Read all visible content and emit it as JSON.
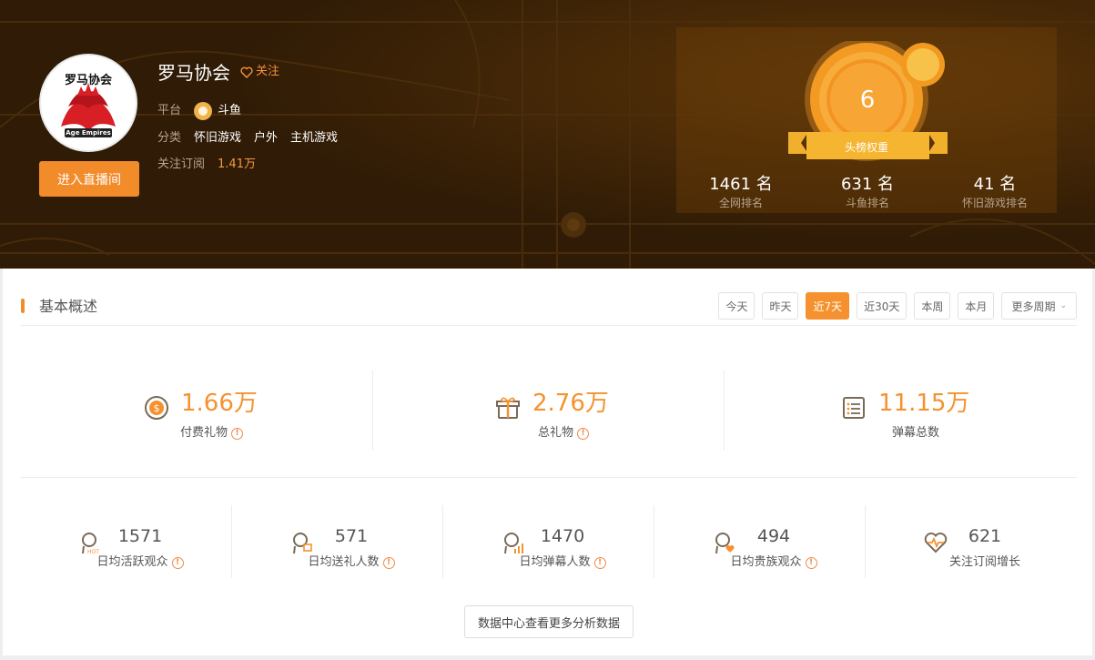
{
  "profile": {
    "avatar_text_top": "罗马协会",
    "avatar_text_bottom": "Age Empires",
    "name": "罗马协会",
    "follow_label": "关注",
    "enter_button": "进入直播间",
    "platform_label": "平台",
    "platform_value": "斗鱼",
    "category_label": "分类",
    "categories": [
      "怀旧游戏",
      "户外",
      "主机游戏"
    ],
    "fans_label": "关注订阅",
    "fans_value": "1.41万"
  },
  "medal": {
    "value": "6",
    "label": "头榜权重"
  },
  "ranks": [
    {
      "value": "1461 名",
      "label": "全网排名"
    },
    {
      "value": "631 名",
      "label": "斗鱼排名"
    },
    {
      "value": "41 名",
      "label": "怀旧游戏排名"
    }
  ],
  "overview": {
    "title": "基本概述",
    "periods": [
      "今天",
      "昨天",
      "近7天",
      "近30天",
      "本周",
      "本月"
    ],
    "active_period": "近7天",
    "more_periods": "更多周期",
    "big_stats": [
      {
        "value": "1.66万",
        "label": "付费礼物",
        "icon": "coin-icon"
      },
      {
        "value": "2.76万",
        "label": "总礼物",
        "icon": "gift-icon"
      },
      {
        "value": "11.15万",
        "label": "弹幕总数",
        "icon": "list-icon"
      }
    ],
    "small_stats": [
      {
        "value": "1571",
        "label": "日均活跃观众",
        "icon": "user-hot-icon",
        "warn": true
      },
      {
        "value": "571",
        "label": "日均送礼人数",
        "icon": "user-gift-icon",
        "warn": true
      },
      {
        "value": "1470",
        "label": "日均弹幕人数",
        "icon": "user-chart-icon",
        "warn": true
      },
      {
        "value": "494",
        "label": "日均贵族观众",
        "icon": "user-heart-icon",
        "warn": true
      },
      {
        "value": "621",
        "label": "关注订阅增长",
        "icon": "heart-pulse-icon",
        "warn": false
      }
    ],
    "more_button": "数据中心查看更多分析数据"
  },
  "colors": {
    "accent": "#f5922f",
    "header_bg": "#3a2208"
  }
}
